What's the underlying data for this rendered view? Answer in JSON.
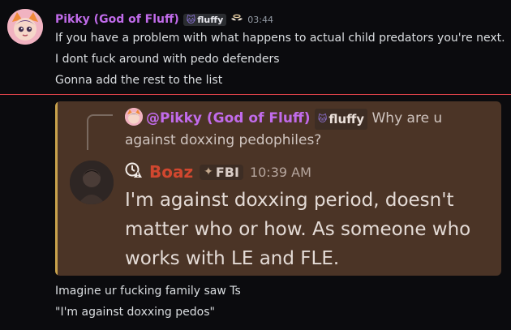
{
  "message": {
    "author": "Pikky (God of Fluff)",
    "tag_label": "fluffy",
    "timestamp": "03:44",
    "lines": [
      "If you have a problem with what happens to actual child predators you're next.",
      "I dont fuck around with pedo defenders",
      "Gonna add the rest to the list"
    ]
  },
  "attachment": {
    "reply": {
      "author": "@Pikky (God of Fluff)",
      "tag_label": "fluffy",
      "text": "Why are u against doxxing pedophiles?"
    },
    "post": {
      "author": "Boaz",
      "tag_label": "FBI",
      "timestamp": "10:39 AM",
      "text": "I'm against doxxing period, doesn't matter who or how. As someone who works with LE and FLE."
    }
  },
  "followups": [
    "Imagine ur fucking family saw Ts",
    "\"I'm against doxxing pedos\""
  ],
  "colors": {
    "background": "#0b0b0e",
    "author_purple": "#c16bea",
    "boaz_red": "#d1472f",
    "divider_red": "#e0434a",
    "attachment_bg": "#4b3426"
  },
  "icons": {
    "tag": "cat-face-icon",
    "halo": "halo-wings-icon",
    "clock": "clock-alert-icon",
    "fbi": "shield-emblem-icon"
  }
}
